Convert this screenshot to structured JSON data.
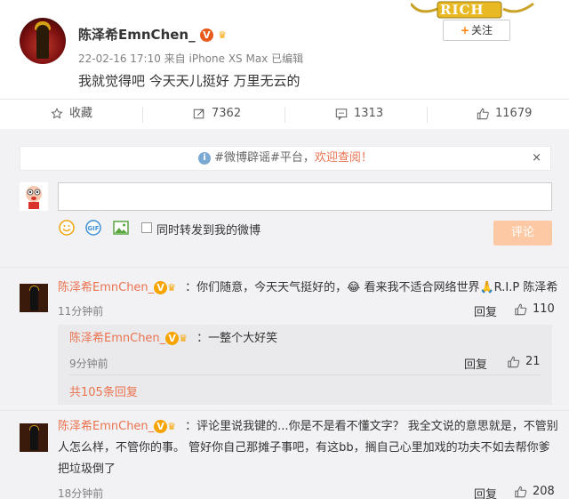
{
  "post": {
    "username": "陈泽希EmnChen_",
    "meta": "22-02-16 17:10 来自 iPhone XS Max  已编辑",
    "text": "我就觉得吧 今天天儿挺好 万里无云的",
    "follow_label": "关注",
    "logo_text": "RICH"
  },
  "actions": {
    "favorite_label": "收藏",
    "repost_count": "7362",
    "comment_count": "1313",
    "like_count": "11679"
  },
  "notice": {
    "prefix": "#微博辟谣#平台，",
    "link": "欢迎查阅！",
    "close": "×"
  },
  "composer": {
    "input_value": "",
    "repost_label": "同时转发到我的微博",
    "submit_label": "评论"
  },
  "comments": [
    {
      "name": "陈泽希EmnChen_",
      "text": "：你们随意，今天天气挺好的，😂 看来我不适合网络世界🙏R.I.P 陈泽希",
      "time": "11分钟前",
      "reply_label": "回复",
      "likes": "110"
    },
    {
      "name": "陈泽希EmnChen_",
      "text_line1": "：评论里说我键的...你是不是看不懂文字？ 我全文说的意思就是，不管别",
      "text_line2": "人怎么样，不管你的事。 管好你自己那摊子事吧，有这bb，搁自己心里加戏的功夫不如去帮你爹",
      "text_line3": "把垃圾倒了",
      "time": "18分钟前",
      "reply_label": "回复",
      "likes": "208"
    }
  ],
  "reply": {
    "name": "陈泽希EmnChen_",
    "text": "：一整个大好笑",
    "time": "9分钟前",
    "reply_label": "回复",
    "likes": "21",
    "more": "共105条回复"
  },
  "colors": {
    "accent": "#eb7350",
    "submit_bg": "#fdc9a5",
    "badge": "#f7a400"
  }
}
